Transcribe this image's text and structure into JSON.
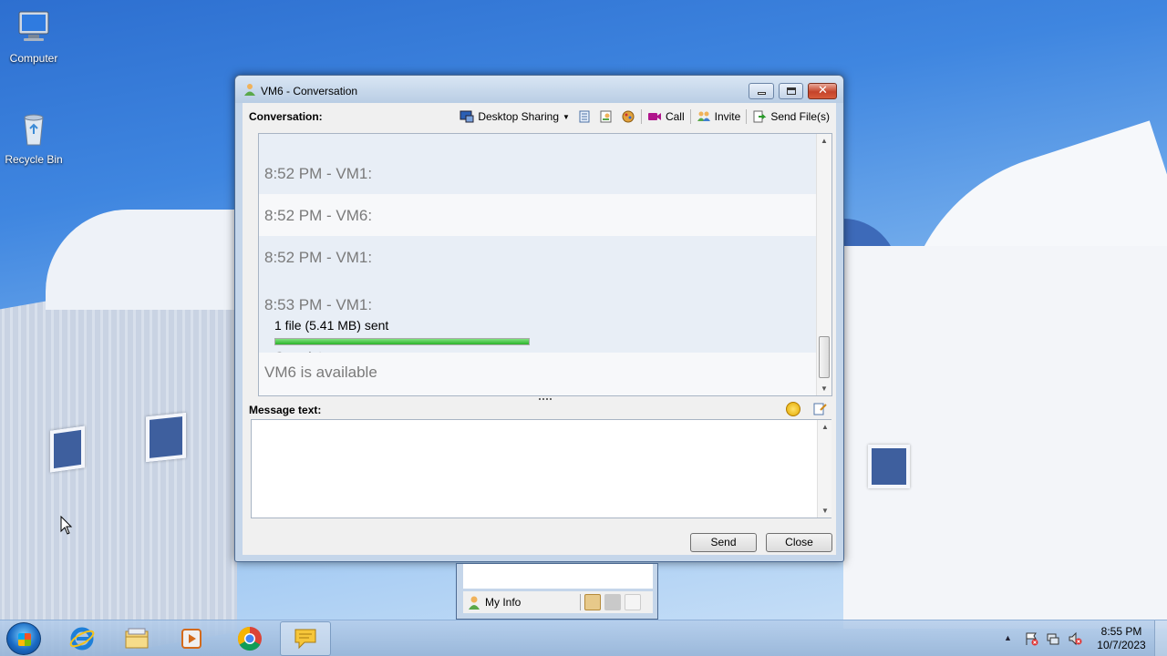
{
  "desktop": {
    "icons": [
      {
        "label": "Computer",
        "icon": "computer-icon"
      },
      {
        "label": "Recycle Bin",
        "icon": "recycle-bin-icon"
      }
    ]
  },
  "window": {
    "title": "VM6 - Conversation",
    "conversation_label": "Conversation:",
    "toolbar": {
      "desktop_sharing": "Desktop Sharing",
      "call": "Call",
      "invite": "Invite",
      "send_files": "Send File(s)"
    },
    "transcript": {
      "messages": [
        {
          "header": "8:52 PM - VM1:"
        },
        {
          "header": "8:52 PM - VM6:"
        },
        {
          "header": "8:52 PM - VM1:"
        },
        {
          "header": "8:53 PM - VM1:",
          "file_text": "1 file (5.41 MB) sent",
          "progress": 1.0,
          "status": "Complete"
        }
      ],
      "status_line": "VM6 is available"
    },
    "message_label": "Message text:",
    "message_value": "",
    "send_label": "Send",
    "close_label": "Close"
  },
  "contact_list": {
    "my_info": "My Info"
  },
  "taskbar": {
    "apps": [
      "internet-explorer-icon",
      "file-explorer-icon",
      "media-player-icon",
      "chrome-icon",
      "messenger-icon"
    ],
    "time": "8:55 PM",
    "date": "10/7/2023"
  },
  "colors": {
    "accent": "#3f86e0",
    "progress": "#2cb32c",
    "close_button": "#c5432a"
  }
}
